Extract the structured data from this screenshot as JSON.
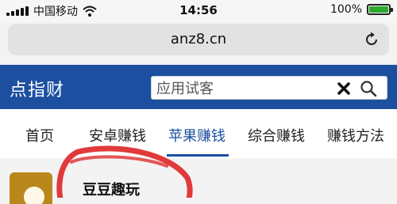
{
  "status_bar": {
    "carrier": "中国移动",
    "time": "14:56",
    "battery_percent": "100%",
    "battery_level": 1.0,
    "wifi_icon": "wifi-icon"
  },
  "browser": {
    "url": "anz8.cn",
    "reload_icon": "reload-icon"
  },
  "site_header": {
    "logo": "点指财",
    "search_placeholder": "应用试客",
    "search_value": "",
    "clear_icon": "close-icon",
    "search_icon": "search-icon",
    "background_color": "#1c4fa0"
  },
  "nav": {
    "items": [
      {
        "label": "首页"
      },
      {
        "label": "安卓赚钱"
      },
      {
        "label": "苹果赚钱"
      },
      {
        "label": "综合赚钱"
      },
      {
        "label": "赚钱方法"
      }
    ],
    "active_index": 2,
    "active_color": "#1c4fa0"
  },
  "content": {
    "apps": [
      {
        "title": "豆豆趣玩"
      }
    ]
  },
  "annotation": {
    "marker_color": "#e03a3a"
  }
}
